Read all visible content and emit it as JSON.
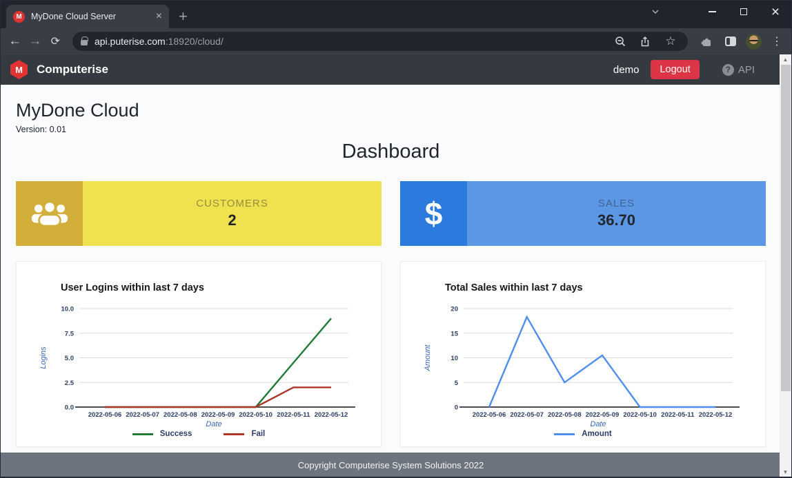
{
  "browser": {
    "tab_title": "MyDone Cloud Server",
    "favicon_letter": "M",
    "url_host": "api.puterise.com",
    "url_suffix": ":18920/cloud/"
  },
  "icons": {
    "back": "←",
    "forward": "→",
    "reload": "⟳",
    "star": "☆",
    "kebab": "⋮",
    "plus": "+",
    "close": "×",
    "scroll_up": "▲",
    "scroll_down": "▼"
  },
  "navbar": {
    "brand": "Computerise",
    "logo_letter": "M",
    "username": "demo",
    "logout_label": "Logout",
    "help_glyph": "?",
    "api_label": "API"
  },
  "page": {
    "title": "MyDone Cloud",
    "version": "Version: 0.01",
    "heading": "Dashboard"
  },
  "cards": [
    {
      "label": "CUSTOMERS",
      "value": "2",
      "icon": "users-group-icon",
      "accent": "#d2ae3a",
      "body_color": "#f0e24f"
    },
    {
      "label": "SALES",
      "value": "36.70",
      "icon": "dollar-icon",
      "glyph": "$",
      "accent": "#2c7ade",
      "body_color": "#5c97e5"
    }
  ],
  "chart_data": [
    {
      "type": "line",
      "title": "User Logins within last 7 days",
      "xlabel": "Date",
      "ylabel": "Logins",
      "categories": [
        "2022-05-06",
        "2022-05-07",
        "2022-05-08",
        "2022-05-09",
        "2022-05-10",
        "2022-05-11",
        "2022-05-12"
      ],
      "series": [
        {
          "name": "Success",
          "color": "#217a38",
          "values": [
            0,
            0,
            0,
            0,
            0,
            4.5,
            9
          ]
        },
        {
          "name": "Fail",
          "color": "#ad3528",
          "values": [
            0,
            0,
            0,
            0,
            0,
            2,
            2
          ]
        }
      ],
      "ylim": [
        0,
        10
      ],
      "yticks": [
        10,
        7.5,
        5,
        2.5,
        0
      ],
      "ytick_labels": [
        "10.0",
        "7.5",
        "5.0",
        "2.5",
        "0.0"
      ],
      "grid": true,
      "legend_position": "bottom"
    },
    {
      "type": "line",
      "title": "Total Sales within last 7 days",
      "xlabel": "Date",
      "ylabel": "Amount",
      "categories": [
        "2022-05-06",
        "2022-05-07",
        "2022-05-08",
        "2022-05-09",
        "2022-05-10",
        "2022-05-11",
        "2022-05-12"
      ],
      "series": [
        {
          "name": "Amount",
          "color": "#4d8ef0",
          "values": [
            0,
            18.3,
            5,
            10.5,
            0,
            0,
            0
          ]
        }
      ],
      "ylim": [
        0,
        20
      ],
      "yticks": [
        20,
        15,
        10,
        5,
        0
      ],
      "ytick_labels": [
        "20",
        "15",
        "10",
        "5",
        "0"
      ],
      "grid": true,
      "legend_position": "bottom"
    }
  ],
  "footer": {
    "copyright": "Copyright Computerise System Solutions 2022"
  }
}
